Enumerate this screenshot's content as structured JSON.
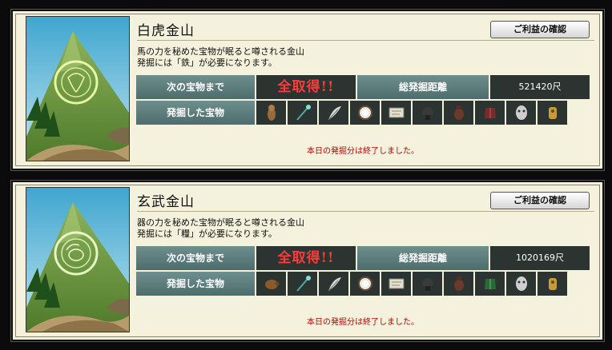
{
  "panels": [
    {
      "title": "白虎金山",
      "button_label": "ご利益の確認",
      "desc_line1": "馬の力を秘めた宝物が眠ると噂される金山",
      "desc_line2": "発掘には「鉄」が必要になります。",
      "next_label": "次の宝物まで",
      "next_value": "全取得!!",
      "distance_label": "総発掘距離",
      "distance_value": "521420尺",
      "found_label": "発掘した宝物",
      "treasure_icons": [
        "figure-icon",
        "wand-icon",
        "feather-icon",
        "mirror-icon",
        "scroll-icon",
        "helmet-icon",
        "urn-icon",
        "armor-icon",
        "mask-icon",
        "idol-icon"
      ],
      "status_message": "本日の発掘分は終了しました。",
      "emblem_icon": "tiger-emblem-icon"
    },
    {
      "title": "玄武金山",
      "button_label": "ご利益の確認",
      "desc_line1": "器の力を秘めた宝物が眠ると噂される金山",
      "desc_line2": "発掘には「糧」が必要になります。",
      "next_label": "次の宝物まで",
      "next_value": "全取得!!",
      "distance_label": "総発掘距離",
      "distance_value": "1020169尺",
      "found_label": "発掘した宝物",
      "treasure_icons": [
        "turtle-icon",
        "wand-icon",
        "feather-icon",
        "mirror-icon",
        "scroll-icon",
        "helmet-icon",
        "urn-icon",
        "armor-icon",
        "mask-icon",
        "idol-icon"
      ],
      "status_message": "本日の発掘分は終了しました。",
      "emblem_icon": "turtle-emblem-icon"
    }
  ],
  "colors": {
    "panel_bg": "#f4f1dc",
    "label_bg": "#5b7c7b",
    "value_bg": "#2c3431",
    "accent_red": "#ff3a3a",
    "message_red": "#c00000"
  }
}
